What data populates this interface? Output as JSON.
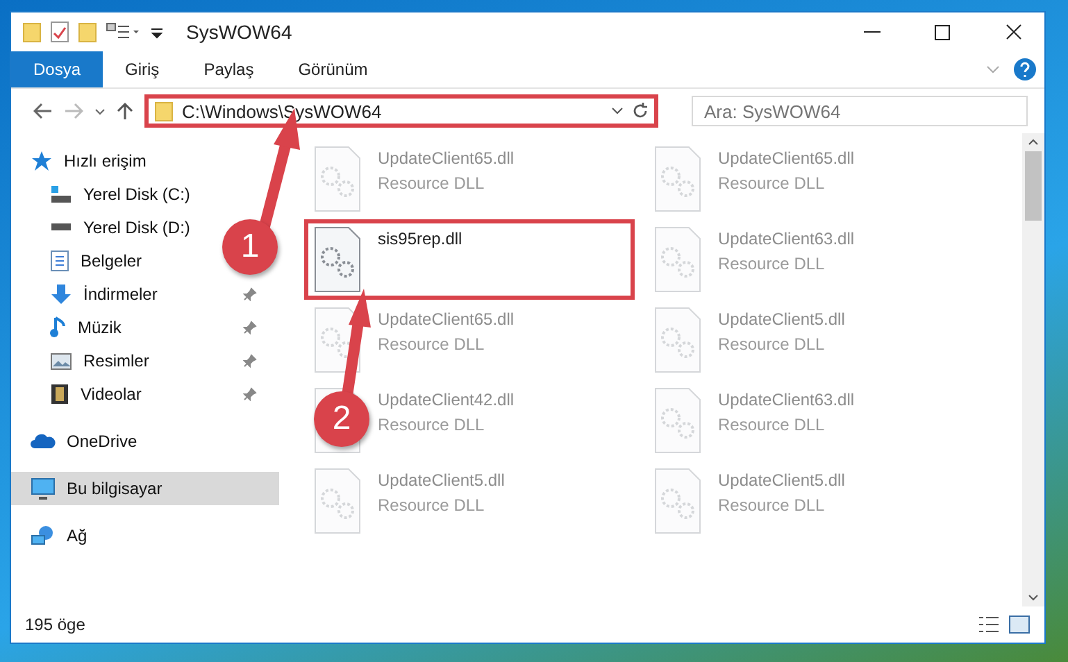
{
  "window": {
    "title": "SysWOW64"
  },
  "ribbon_tabs": [
    {
      "label": "Dosya",
      "selected": true
    },
    {
      "label": "Giriş",
      "selected": false
    },
    {
      "label": "Paylaş",
      "selected": false
    },
    {
      "label": "Görünüm",
      "selected": false
    }
  ],
  "address_bar": {
    "path": "C:\\Windows\\SysWOW64",
    "highlighted": true
  },
  "search": {
    "placeholder": "Ara: SysWOW64"
  },
  "sidebar": {
    "items": [
      {
        "label": "Hızlı erişim",
        "pinned": false,
        "selected": false,
        "children": [
          {
            "label": "Yerel Disk (C:)",
            "pinned": false,
            "selected": false
          },
          {
            "label": "Yerel Disk (D:)",
            "pinned": false,
            "selected": false
          },
          {
            "label": "Belgeler",
            "pinned": false,
            "selected": false
          },
          {
            "label": "İndirmeler",
            "pinned": true,
            "selected": false
          },
          {
            "label": "Müzik",
            "pinned": true,
            "selected": false
          },
          {
            "label": "Resimler",
            "pinned": true,
            "selected": false
          },
          {
            "label": "Videolar",
            "pinned": true,
            "selected": false
          }
        ]
      },
      {
        "label": "OneDrive",
        "pinned": false,
        "selected": false
      },
      {
        "label": "Bu bilgisayar",
        "pinned": false,
        "selected": true
      },
      {
        "label": "Ağ",
        "pinned": false,
        "selected": false
      }
    ]
  },
  "files": [
    {
      "name": "UpdateClient65.dll",
      "type": "Resource DLL",
      "dimmed": true,
      "highlighted": false
    },
    {
      "name": "UpdateClient65.dll",
      "type": "Resource DLL",
      "dimmed": true,
      "highlighted": false
    },
    {
      "name": "sis95rep.dll",
      "dimmed": false,
      "highlighted": true
    },
    {
      "name": "UpdateClient63.dll",
      "type": "Resource DLL",
      "dimmed": true,
      "highlighted": false
    },
    {
      "name": "UpdateClient65.dll",
      "type": "Resource DLL",
      "dimmed": true,
      "highlighted": false
    },
    {
      "name": "UpdateClient5.dll",
      "type": "Resource DLL",
      "dimmed": true,
      "highlighted": false
    },
    {
      "name": "UpdateClient42.dll",
      "type": "Resource DLL",
      "dimmed": true,
      "highlighted": false
    },
    {
      "name": "UpdateClient63.dll",
      "type": "Resource DLL",
      "dimmed": true,
      "highlighted": false
    },
    {
      "name": "UpdateClient5.dll",
      "type": "Resource DLL",
      "dimmed": true,
      "highlighted": false
    },
    {
      "name": "UpdateClient5.dll",
      "type": "Resource DLL",
      "dimmed": true,
      "highlighted": false
    }
  ],
  "status_bar": {
    "item_count": "195 öge"
  },
  "annotations": [
    {
      "number": "1"
    },
    {
      "number": "2"
    }
  ]
}
